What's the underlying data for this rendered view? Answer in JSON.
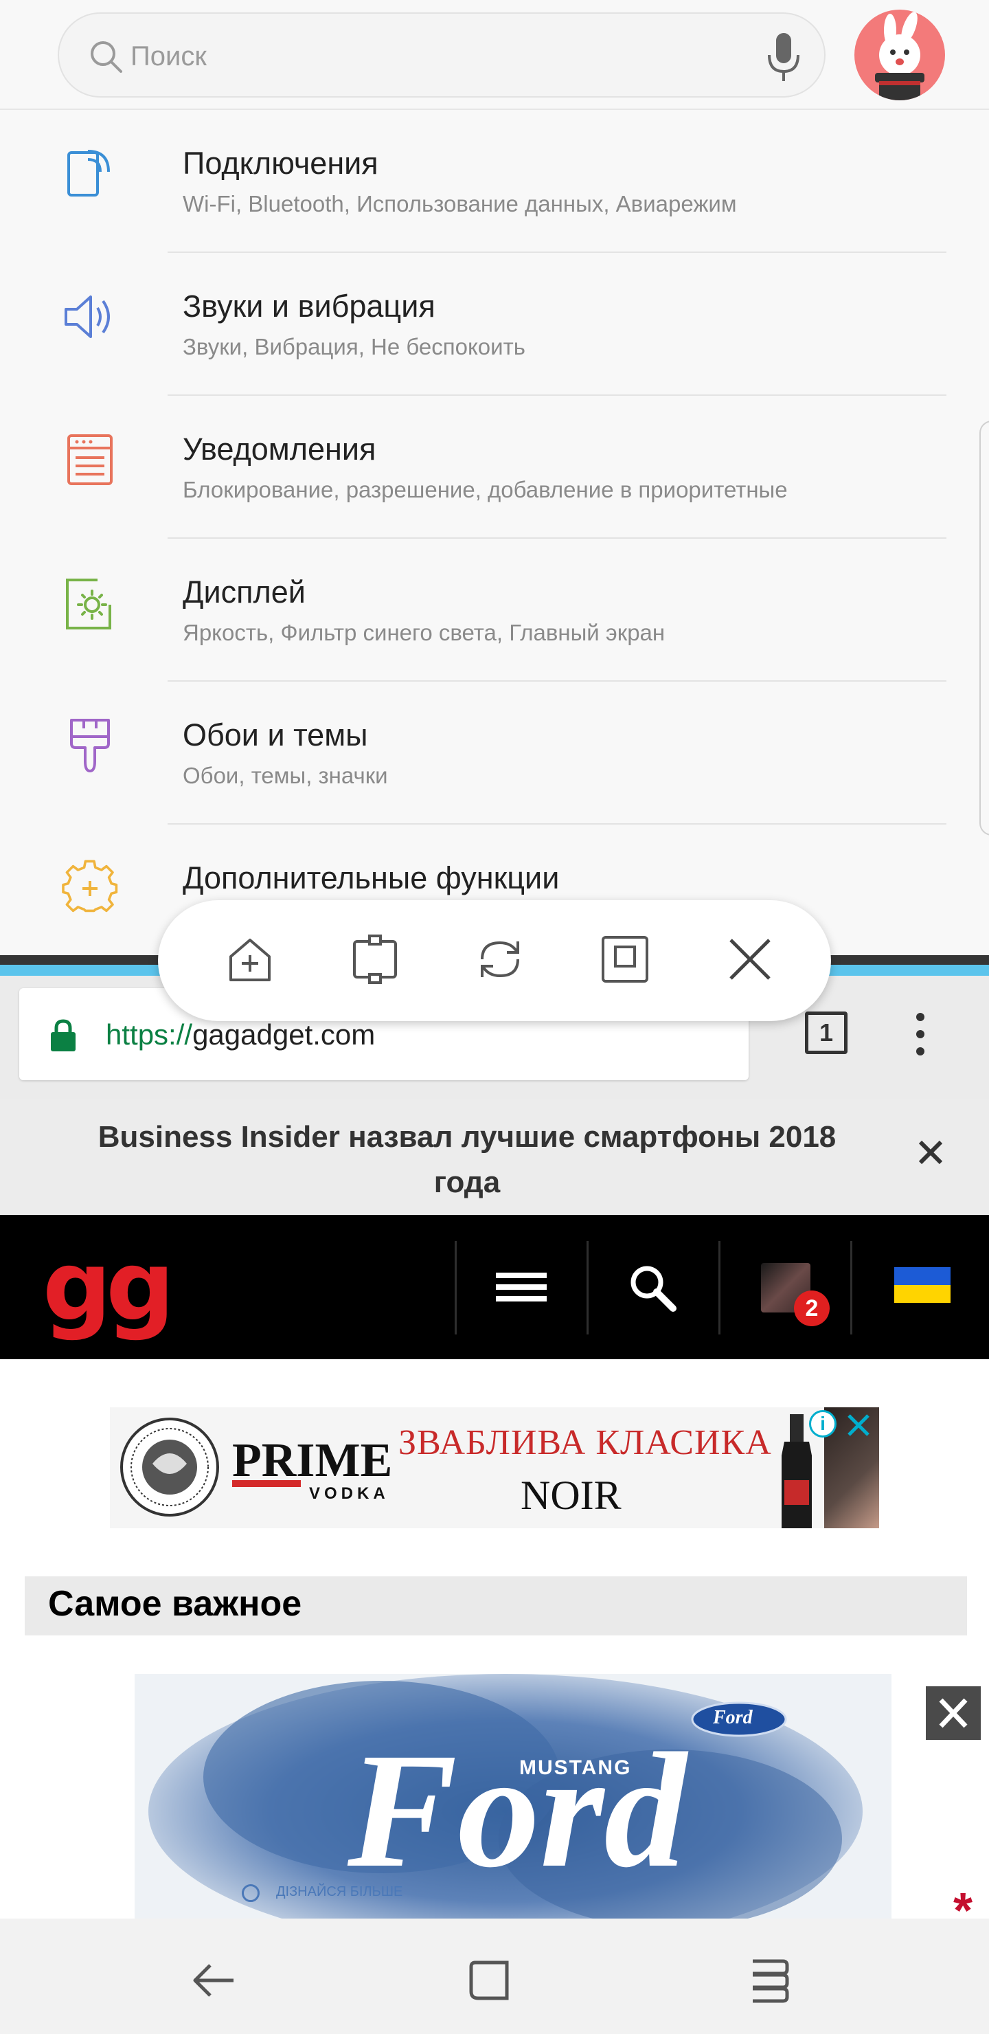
{
  "settings": {
    "search": {
      "placeholder": "Поиск"
    },
    "items": [
      {
        "title": "Подключения",
        "subtitle": "Wi-Fi, Bluetooth, Использование данных, Авиарежим",
        "icon": "connections-icon",
        "color": "#3b8fd6"
      },
      {
        "title": "Звуки и вибрация",
        "subtitle": "Звуки, Вибрация, Не беспокоить",
        "icon": "sound-icon",
        "color": "#5b7fd6"
      },
      {
        "title": "Уведомления",
        "subtitle": "Блокирование, разрешение, добавление в приоритетные",
        "icon": "notifications-icon",
        "color": "#e8745c"
      },
      {
        "title": "Дисплей",
        "subtitle": "Яркость, Фильтр синего света, Главный экран",
        "icon": "display-icon",
        "color": "#78b348"
      },
      {
        "title": "Обои и темы",
        "subtitle": "Обои, темы, значки",
        "icon": "themes-icon",
        "color": "#a066c8"
      },
      {
        "title": "Дополнительные функции",
        "subtitle": "",
        "icon": "advanced-features-icon",
        "color": "#f0b43c"
      }
    ]
  },
  "split_toolbar": {
    "buttons": [
      "add-shortcut-icon",
      "screen-resize-icon",
      "swap-windows-icon",
      "pop-up-view-icon",
      "close-icon"
    ]
  },
  "browser": {
    "url_scheme": "https://",
    "url_host": "gagadget.com",
    "tab_count": "1",
    "banner_text": "Business Insider назвал лучшие смартфоны 2018 года",
    "site_logo": "gg",
    "notification_count": "2",
    "ad1": {
      "brand": "PRIME",
      "brand_sub": "VODKA",
      "slogan_line1": "ЗВАБЛИВА КЛАСИКА",
      "slogan_line2": "NOIR"
    },
    "section_title": "Самое важное",
    "ad2": {
      "brand": "Ford",
      "model": "MUSTANG",
      "cta": "ДІЗНАЙСЯ БІЛЬШЕ"
    },
    "accent_red": "#e21f26",
    "scheme_green": "#0b8043"
  },
  "nav": {
    "buttons": [
      "back-icon",
      "home-icon",
      "recents-icon"
    ]
  }
}
